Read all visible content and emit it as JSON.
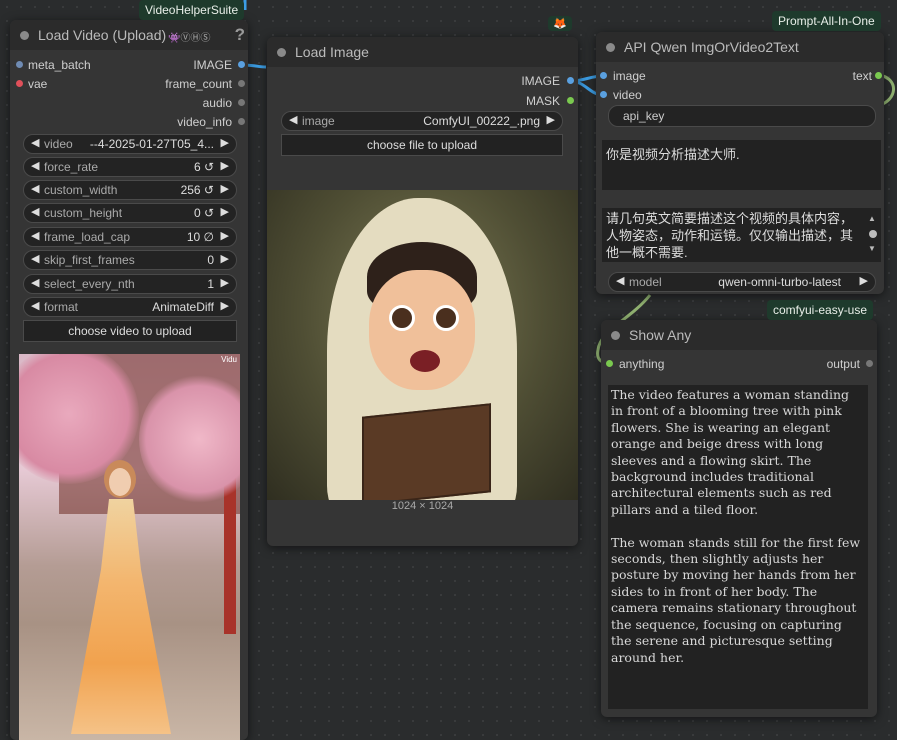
{
  "nodes": {
    "load_video": {
      "title": "Load Video (Upload)",
      "badge": "VideoHelperSuite",
      "header_icons": "👾ⓋⒽⓈ",
      "help": "?",
      "inputs": [
        "meta_batch",
        "vae"
      ],
      "outputs": [
        "IMAGE",
        "frame_count",
        "audio",
        "video_info"
      ],
      "widgets": [
        {
          "label": "video",
          "value": "--4-2025-01-27T05_4..."
        },
        {
          "label": "force_rate",
          "value": "6 ↺"
        },
        {
          "label": "custom_width",
          "value": "256 ↺"
        },
        {
          "label": "custom_height",
          "value": "0 ↺"
        },
        {
          "label": "frame_load_cap",
          "value": "10 ∅"
        },
        {
          "label": "skip_first_frames",
          "value": "0"
        },
        {
          "label": "select_every_nth",
          "value": "1"
        },
        {
          "label": "format",
          "value": "AnimateDiff"
        }
      ],
      "upload_button": "choose video to upload",
      "preview_watermark": "Vidu"
    },
    "load_image": {
      "title": "Load Image",
      "outputs": [
        "IMAGE",
        "MASK"
      ],
      "widget": {
        "label": "image",
        "value": "ComfyUI_00222_.png"
      },
      "upload_button": "choose file to upload",
      "image_size": "1024 × 1024"
    },
    "api_qwen": {
      "title": "API Qwen ImgOrVideo2Text",
      "badge": "Prompt-All-In-One",
      "inputs": [
        "image",
        "video"
      ],
      "outputs": [
        "text"
      ],
      "api_key_placeholder": "api_key",
      "system_prompt": "你是视频分析描述大师.",
      "user_prompt": "请几句英文简要描述这个视频的具体内容，人物姿态，动作和运镜。仅仅输出描述，其他一概不需要.",
      "model": {
        "label": "model",
        "value": "qwen-omni-turbo-latest"
      }
    },
    "show_any": {
      "title": "Show Any",
      "badge": "comfyui-easy-use",
      "inputs": [
        "anything"
      ],
      "outputs": [
        "output"
      ],
      "text": "The video features a woman standing in front of a blooming tree with pink flowers. She is wearing an elegant orange and beige dress with long sleeves and a flowing skirt. The background includes traditional architectural elements such as red pillars and a tiled floor.\n\nThe woman stands still for the first few seconds, then slightly adjusts her posture by moving her hands from her sides to in front of her body. The camera remains stationary throughout the sequence, focusing on capturing the serene and picturesque setting around her."
    },
    "floating_badge": "🦊"
  },
  "colors": {
    "link_blue": "#3c9ee5",
    "slot_green": "#7ac94f",
    "slot_red": "#e0505a",
    "slot_blue": "#5aa0e0",
    "badge_bg": "#1e3a2c"
  }
}
